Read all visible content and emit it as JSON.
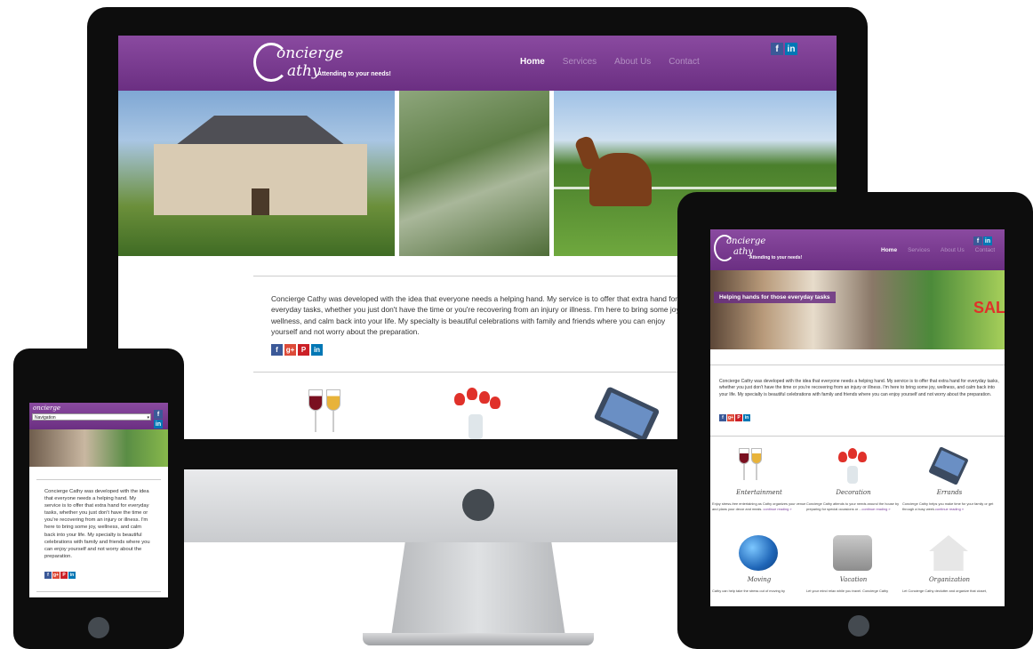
{
  "site": {
    "logo_line1": "oncierge",
    "logo_line2": "athy",
    "tagline": "Attending to your needs!",
    "nav": [
      "Home",
      "Services",
      "About Us",
      "Contact"
    ],
    "active_nav": "Home",
    "social": {
      "facebook": "f",
      "linkedin": "in"
    },
    "intro_text": "Concierge Cathy was developed with the idea that everyone needs a helping hand. My service is to offer that extra hand for everyday tasks, whether you just don't have the time or you're recovering from an injury or illness. I'm here to bring some joy, wellness, and calm back into your life. My specialty is beautiful celebrations with family and friends where you can enjoy yourself and not worry about the preparation.",
    "share": {
      "facebook": "f",
      "google_plus": "g+",
      "pinterest": "P",
      "linkedin": "in"
    }
  },
  "phone": {
    "nav_select": "Navigation"
  },
  "tablet": {
    "hero_caption": "Helping hands for those everyday tasks",
    "hero_sign": "SALE",
    "services": [
      {
        "title": "Entertainment",
        "desc": "Enjoy stress-free entertaining as Cathy organizes your venue and plans your decor and meals.",
        "more": "continue reading »"
      },
      {
        "title": "Decoration",
        "desc": "Concierge Cathy attends to your needs around the house by preparing for special occasions or ...",
        "more": "continue reading »"
      },
      {
        "title": "Errands",
        "desc": "Concierge Cathy helps you make time for your family or get through a busy week.",
        "more": "continue reading »"
      },
      {
        "title": "Moving",
        "desc": "Cathy can help take the stress out of moving by",
        "more": ""
      },
      {
        "title": "Vacation",
        "desc": "Let your mind relax while you travel. Concierge Cathy",
        "more": ""
      },
      {
        "title": "Organization",
        "desc": "Let Concierge Cathy declutter and organize that closet,",
        "more": ""
      }
    ]
  },
  "colors": {
    "brand_purple": "#6b2f82",
    "nav_inactive": "#b38fc3",
    "link": "#7a3e9a"
  }
}
